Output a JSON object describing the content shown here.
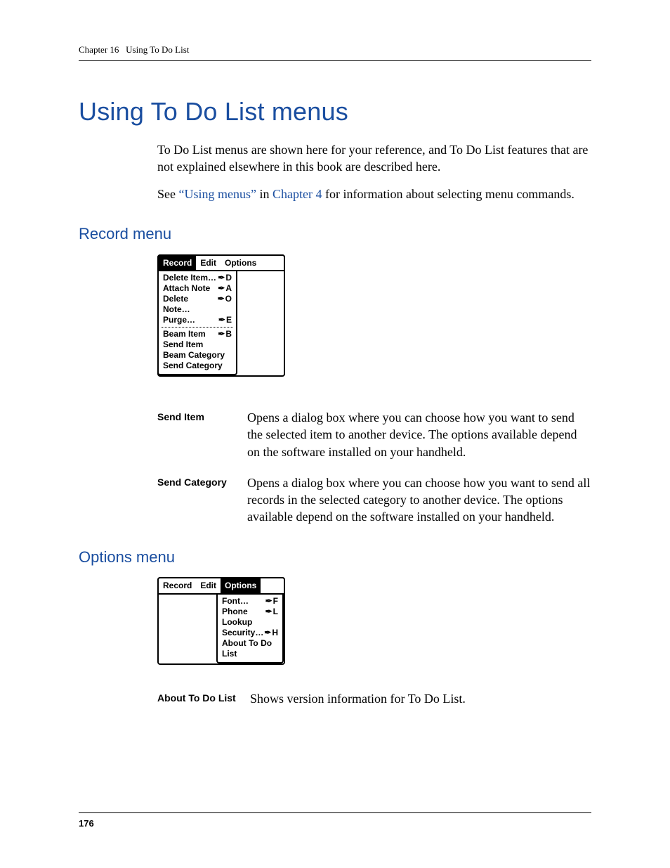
{
  "header": {
    "chapter": "Chapter 16",
    "title": "Using To Do List"
  },
  "h1": "Using To Do List menus",
  "intro": {
    "p1": "To Do List menus are shown here for your reference, and To Do List features that are not explained elsewhere in this book are described here.",
    "p2_pre": "See ",
    "p2_link1": "“Using menus”",
    "p2_mid": " in ",
    "p2_link2": "Chapter 4",
    "p2_post": " for information about selecting menu commands."
  },
  "record": {
    "heading": "Record menu",
    "menubar": {
      "record": "Record",
      "edit": "Edit",
      "options": "Options"
    },
    "items_top": [
      {
        "label": "Delete Item…",
        "sc": "D"
      },
      {
        "label": "Attach Note",
        "sc": "A"
      },
      {
        "label": "Delete Note…",
        "sc": "O"
      },
      {
        "label": "Purge…",
        "sc": "E"
      }
    ],
    "items_bottom": [
      {
        "label": "Beam Item",
        "sc": "B"
      },
      {
        "label": "Send Item",
        "sc": ""
      },
      {
        "label": "Beam Category",
        "sc": ""
      },
      {
        "label": "Send Category",
        "sc": ""
      }
    ],
    "defs": [
      {
        "term": "Send Item",
        "desc": "Opens a dialog box where you can choose how you want to send the selected item to another device. The options available depend on the software installed on your handheld."
      },
      {
        "term": "Send Category",
        "desc": "Opens a dialog box where you can choose how you want to send all records in the selected category to another device. The options available depend on the software installed on your handheld."
      }
    ]
  },
  "options": {
    "heading": "Options menu",
    "menubar": {
      "record": "Record",
      "edit": "Edit",
      "options": "Options"
    },
    "items": [
      {
        "label": "Font…",
        "sc": "F"
      },
      {
        "label": "Phone Lookup",
        "sc": "L"
      },
      {
        "label": "Security…",
        "sc": "H"
      },
      {
        "label": "About To Do List",
        "sc": ""
      }
    ],
    "defs": [
      {
        "term": "About To Do List",
        "desc": "Shows version information for To Do List."
      }
    ]
  },
  "page_number": "176"
}
